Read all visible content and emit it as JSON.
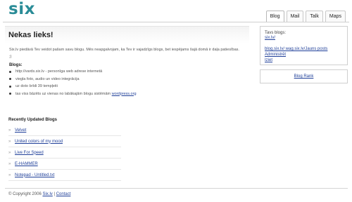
{
  "logo": "six",
  "tabs": [
    {
      "label": "Blog",
      "active": true
    },
    {
      "label": "Mail",
      "active": false
    },
    {
      "label": "Talk",
      "active": false
    },
    {
      "label": "Maps",
      "active": false
    }
  ],
  "main": {
    "title": "Nekas lieks!",
    "intro": "Six.lv piedāvā Tev veidot pašam savu blogu. Mēs neapgalvojam, ka Tev ir vajadzīgs blogs, bet iespējams šajā domā ir daļa patiesības. ;)",
    "blogs_label": "Blogs:",
    "features": [
      "http://vards.six.lv - personīga web adrese internetā",
      "viegla foto, audio un video integrācija",
      "uz doto brīdi 39 tempļeiti"
    ],
    "last_feature_text": "tas viss bāzēts uz vienas no labākajām blogu sistēmām ",
    "last_feature_link": "wordpress.org"
  },
  "recent": {
    "title": "Recently Updated Blogs",
    "items": [
      "Velvet",
      "United colors of my mood",
      "Live For Speed",
      "E-HAMMER",
      "Notepad - Untitled.txt"
    ]
  },
  "sidebar": {
    "tavs_label": "Tavs blogs: ",
    "tavs_link": "six.lv/",
    "links": [
      "blog.six.lv/ wag.six.lv/Jauns posts",
      "Administrēt",
      "Iziet"
    ],
    "blog_rank": "Blog Rank"
  },
  "footer": {
    "copyright": "© Copyright 2006 ",
    "site_link": "Six.lv",
    "separator": " | ",
    "contact": "Contact"
  },
  "colors": {
    "logo": "#2a8c97",
    "link": "#1f3f99"
  }
}
